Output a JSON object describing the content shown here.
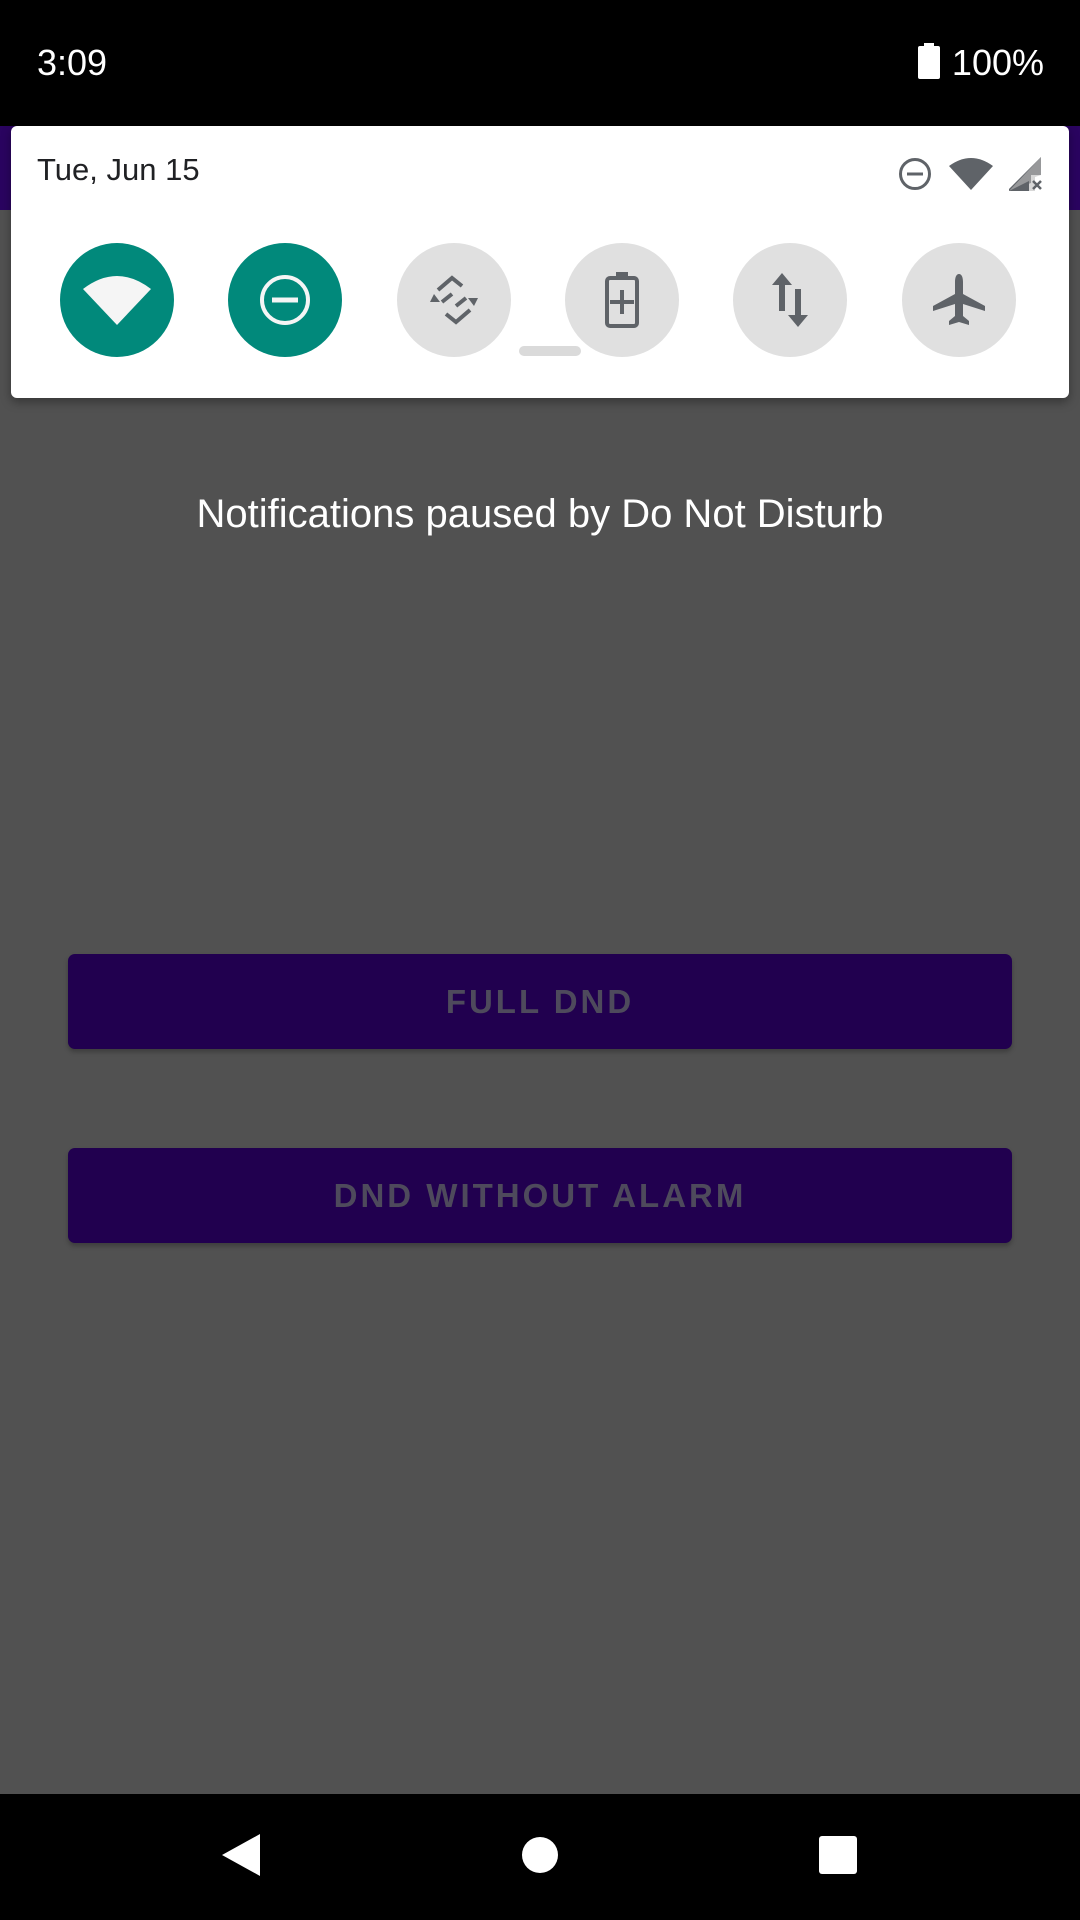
{
  "status_bar": {
    "time": "3:09",
    "battery_percent": "100%",
    "battery_icon": "battery-full-icon"
  },
  "quick_settings": {
    "date": "Tue, Jun 15",
    "status_icons": [
      "dnd-icon",
      "wifi-icon",
      "cell-signal-no-service-icon"
    ],
    "tiles": [
      {
        "name": "wifi",
        "icon": "wifi-icon",
        "state": "on"
      },
      {
        "name": "do-not-disturb",
        "icon": "dnd-icon",
        "state": "on"
      },
      {
        "name": "auto-rotate",
        "icon": "auto-rotate-icon",
        "state": "off"
      },
      {
        "name": "battery-saver",
        "icon": "battery-saver-icon",
        "state": "off"
      },
      {
        "name": "mobile-data",
        "icon": "mobile-data-icon",
        "state": "off"
      },
      {
        "name": "airplane-mode",
        "icon": "airplane-icon",
        "state": "off"
      }
    ],
    "colors": {
      "tile_on": "#01897b",
      "tile_off": "#e0e0e0",
      "icon_off": "#5f6368"
    }
  },
  "main": {
    "dnd_message": "Notifications paused by Do Not Disturb",
    "buttons": {
      "full_dnd": "FULL DND",
      "dnd_without_alarm": "DND WITHOUT ALARM"
    },
    "colors": {
      "button_bg": "#21004f",
      "scrim": "#515151"
    }
  },
  "nav_bar": {
    "icons": [
      "back-icon",
      "home-icon",
      "recents-icon"
    ]
  }
}
